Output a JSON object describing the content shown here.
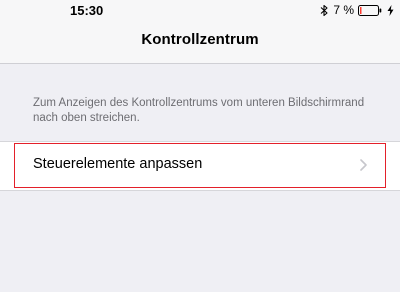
{
  "status_bar": {
    "time": "15:30",
    "battery_percent": "7 %",
    "battery_level": 0.07,
    "battery_color": "#ff3b30"
  },
  "nav": {
    "title": "Kontrollzentrum"
  },
  "hint_text": "Zum Anzeigen des Kontrollzentrums vom unteren Bildschirmrand nach oben streichen.",
  "rows": [
    {
      "label": "Steuerelemente anpassen",
      "icon": "chevron-right-icon"
    }
  ],
  "colors": {
    "background": "#efeff4",
    "highlight": "#e3202a",
    "hint": "#6d6d72"
  }
}
